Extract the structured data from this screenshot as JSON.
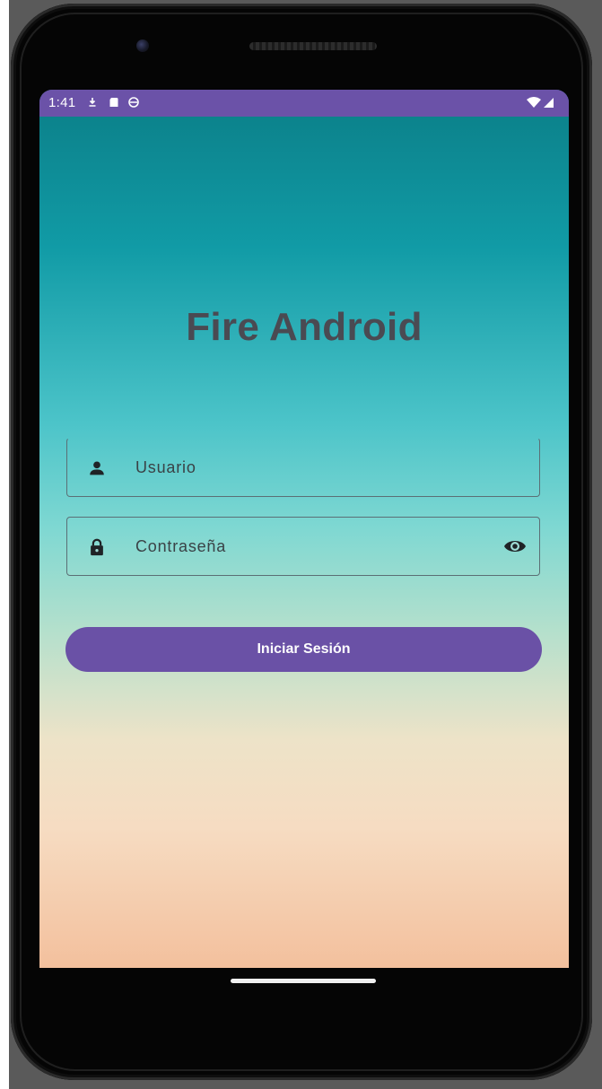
{
  "status_bar": {
    "time": "1:41",
    "background_color": "#6b52a8",
    "left_icons": [
      "download-icon",
      "sd-card-icon",
      "sync-icon"
    ],
    "right_icons": [
      "wifi-icon",
      "signal-icon"
    ]
  },
  "app": {
    "title": "Fire Android"
  },
  "login_form": {
    "username": {
      "placeholder": "Usuario",
      "value": "",
      "icon": "person-icon"
    },
    "password": {
      "placeholder": "Contraseña",
      "value": "",
      "icon": "lock-icon",
      "toggle_icon": "eye-icon"
    },
    "submit_label": "Iniciar Sesión",
    "button_color": "#6a51a6"
  },
  "theme": {
    "gradient_top": "#0b7e87",
    "gradient_middle": "#7fd8d2",
    "gradient_bottom": "#f3c09d"
  }
}
